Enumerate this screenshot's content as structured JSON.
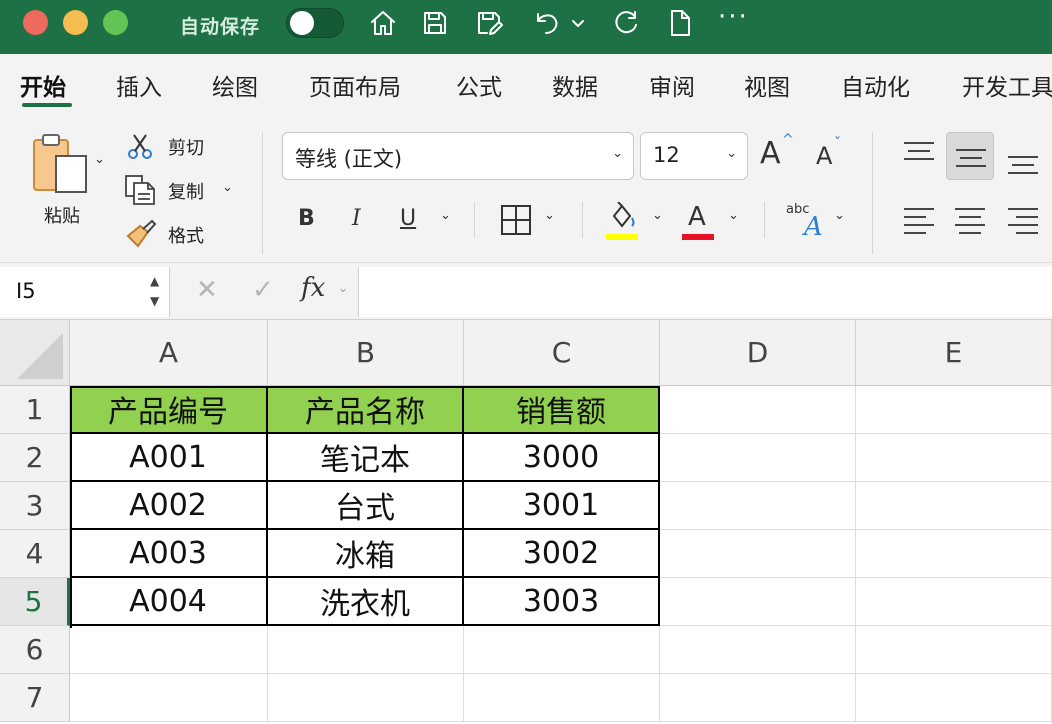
{
  "window": {
    "autosave_label": "自动保存",
    "autosave_on": false
  },
  "title_icons": [
    "home-icon",
    "save-icon",
    "save-as-icon",
    "undo-icon",
    "redo-icon",
    "new-file-icon",
    "more-icon"
  ],
  "toolbar_more": "···",
  "ribbon_tabs": [
    {
      "label": "开始",
      "active": true
    },
    {
      "label": "插入"
    },
    {
      "label": "绘图"
    },
    {
      "label": "页面布局"
    },
    {
      "label": "公式"
    },
    {
      "label": "数据"
    },
    {
      "label": "审阅"
    },
    {
      "label": "视图"
    },
    {
      "label": "自动化"
    },
    {
      "label": "开发工具"
    }
  ],
  "clipboard": {
    "paste_label": "粘贴",
    "cut_label": "剪切",
    "copy_label": "复制",
    "format_label": "格式"
  },
  "font": {
    "name": "等线 (正文)",
    "size": "12",
    "bold": "B",
    "italic": "I",
    "underline": "U",
    "font_color_glyph": "A",
    "grow_glyph": "A",
    "shrink_glyph": "A",
    "abc_label": "abc",
    "fill_color": "#ffff00",
    "text_color": "#e81123"
  },
  "formula_bar": {
    "name_box": "I5",
    "cancel": "✕",
    "enter": "✓",
    "fx": "fx",
    "formula": ""
  },
  "sheet": {
    "columns": [
      "A",
      "B",
      "C",
      "D",
      "E"
    ],
    "rows": [
      "1",
      "2",
      "3",
      "4",
      "5",
      "6",
      "7"
    ],
    "selected_row": "5",
    "header_fill": "#92d050",
    "cells": [
      [
        "产品编号",
        "产品名称",
        "销售额",
        "",
        ""
      ],
      [
        "A001",
        "笔记本",
        "3000",
        "",
        ""
      ],
      [
        "A002",
        "台式",
        "3001",
        "",
        ""
      ],
      [
        "A003",
        "冰箱",
        "3002",
        "",
        ""
      ],
      [
        "A004",
        "洗衣机",
        "3003",
        "",
        ""
      ],
      [
        "",
        "",
        "",
        "",
        ""
      ],
      [
        "",
        "",
        "",
        "",
        ""
      ]
    ]
  }
}
